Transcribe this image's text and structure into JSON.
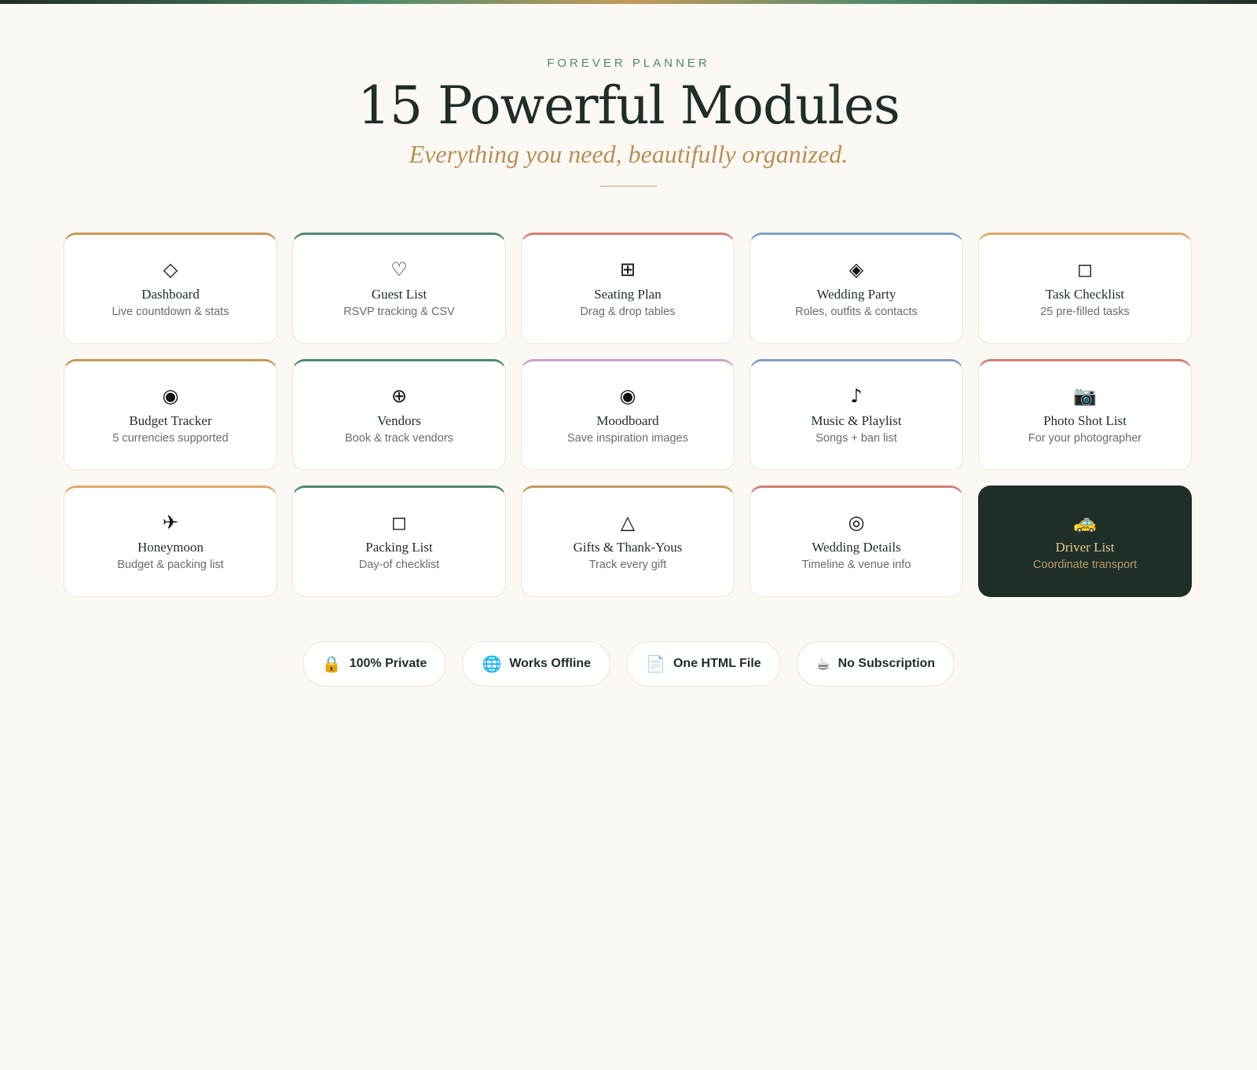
{
  "header": {
    "eyebrow": "FOREVER PLANNER",
    "title": "15 Powerful Modules",
    "subtitle": "Everything you need, beautifully organized."
  },
  "colors": {
    "accent_gold": "#c49a5a",
    "accent_green": "#4f8a6a",
    "accent_red": "#d47d72",
    "accent_blue": "#7f9fc4",
    "accent_orange": "#e0a869",
    "accent_purple": "#c9a3c9",
    "dark": "#1f2e27"
  },
  "modules": [
    {
      "icon_name": "diamond-outline-icon",
      "glyph": "◇",
      "name": "Dashboard",
      "desc": "Live countdown & stats",
      "accent": "#c49a5a"
    },
    {
      "icon_name": "heart-outline-icon",
      "glyph": "♡",
      "name": "Guest List",
      "desc": "RSVP tracking & CSV",
      "accent": "#4f8a6a"
    },
    {
      "icon_name": "grid-icon",
      "glyph": "⊞",
      "name": "Seating Plan",
      "desc": "Drag & drop tables",
      "accent": "#d47d72"
    },
    {
      "icon_name": "diamond-filled-icon",
      "glyph": "◈",
      "name": "Wedding Party",
      "desc": "Roles, outfits & contacts",
      "accent": "#7f9fc4"
    },
    {
      "icon_name": "square-outline-icon",
      "glyph": "◻",
      "name": "Task Checklist",
      "desc": "25 pre-filled tasks",
      "accent": "#e0a869"
    },
    {
      "icon_name": "target-icon",
      "glyph": "◉",
      "name": "Budget Tracker",
      "desc": "5 currencies supported",
      "accent": "#c49a5a"
    },
    {
      "icon_name": "circle-plus-icon",
      "glyph": "⊕",
      "name": "Vendors",
      "desc": "Book & track vendors",
      "accent": "#4f8a6a"
    },
    {
      "icon_name": "target-icon",
      "glyph": "◉",
      "name": "Moodboard",
      "desc": "Save inspiration images",
      "accent": "#c9a3c9"
    },
    {
      "icon_name": "music-note-icon",
      "glyph": "♪",
      "name": "Music & Playlist",
      "desc": "Songs + ban list",
      "accent": "#7f9fc4"
    },
    {
      "icon_name": "camera-icon",
      "glyph": "📷",
      "name": "Photo Shot List",
      "desc": "For your photographer",
      "accent": "#d47d72"
    },
    {
      "icon_name": "airplane-icon",
      "glyph": "✈",
      "name": "Honeymoon",
      "desc": "Budget & packing list",
      "accent": "#e0a869"
    },
    {
      "icon_name": "square-outline-icon",
      "glyph": "◻",
      "name": "Packing List",
      "desc": "Day-of checklist",
      "accent": "#4f8a6a"
    },
    {
      "icon_name": "triangle-outline-icon",
      "glyph": "△",
      "name": "Gifts & Thank-Yous",
      "desc": "Track every gift",
      "accent": "#c49a5a"
    },
    {
      "icon_name": "double-circle-icon",
      "glyph": "◎",
      "name": "Wedding Details",
      "desc": "Timeline & venue info",
      "accent": "#d47d72"
    },
    {
      "icon_name": "taxi-icon",
      "glyph": "🚕",
      "name": "Driver List",
      "desc": "Coordinate transport",
      "accent": "#1f2e27"
    }
  ],
  "badges": [
    {
      "icon_name": "lock-icon",
      "glyph": "🔒",
      "label": "100% Private"
    },
    {
      "icon_name": "globe-icon",
      "glyph": "🌐",
      "label": "Works Offline"
    },
    {
      "icon_name": "document-icon",
      "glyph": "📄",
      "label": "One HTML File"
    },
    {
      "icon_name": "coffee-icon",
      "glyph": "☕",
      "label": "No Subscription"
    }
  ]
}
